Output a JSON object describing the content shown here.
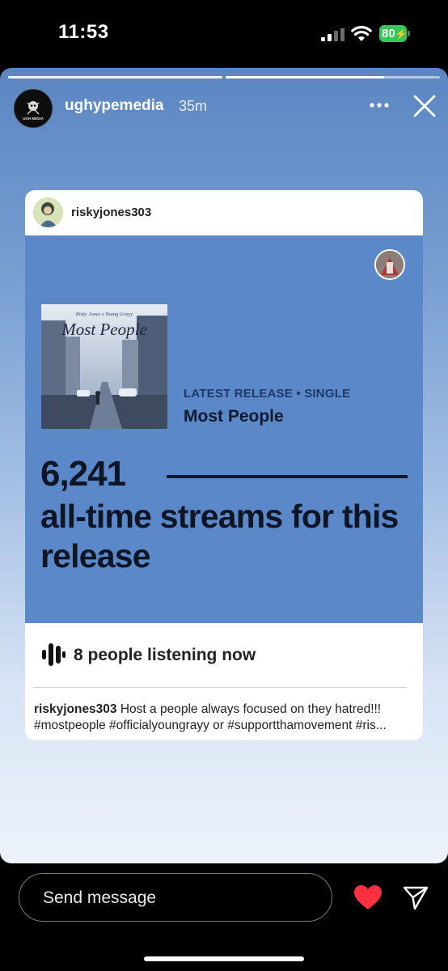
{
  "status_bar": {
    "time": "11:53",
    "battery": "80"
  },
  "story": {
    "progress_segments": 2,
    "current_segment_progress": 0.74,
    "account": {
      "username": "ughypemedia",
      "time_ago": "35m",
      "avatar_text": "UGH MEDIA"
    },
    "icons": {
      "more": "more-horizontal-icon",
      "close": "close-icon"
    }
  },
  "shared_card": {
    "username": "riskyjones303",
    "panel_color": "#5b88c9",
    "album": {
      "cover_title": "Most People",
      "cover_artists": "Risky Jones x Young Grayy"
    },
    "release_kicker": "LATEST RELEASE • SINGLE",
    "release_title": "Most People",
    "streams_count": "6,241",
    "streams_caption": "all-time streams for this release",
    "listening_now": "8 people listening now",
    "caption_user": "riskyjones303",
    "caption_line1": "Host a people always focused on they hatred!!!",
    "caption_line2": "#mostpeople #officialyoungrayy or #supportthamovement #ris..."
  },
  "bottom_bar": {
    "reply_placeholder": "Send message",
    "like_color": "#ff3040",
    "icons": {
      "like": "heart-icon",
      "share": "send-icon"
    }
  }
}
